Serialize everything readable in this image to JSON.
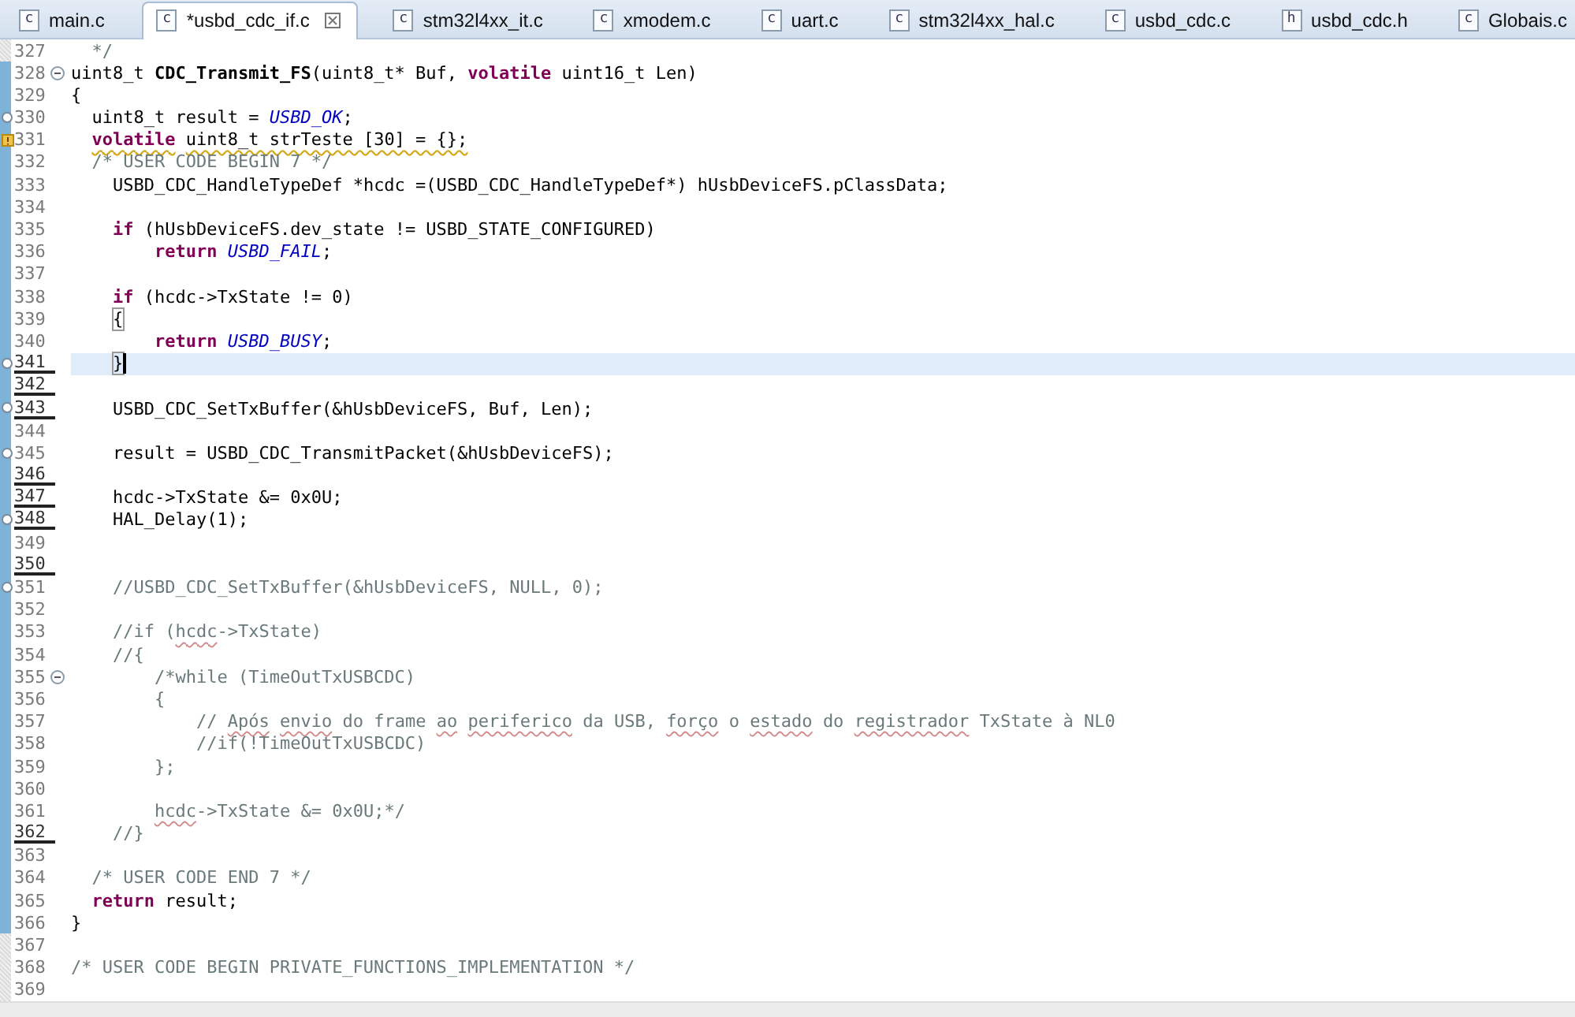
{
  "tabs": [
    {
      "label": "main.c",
      "icon_letter": "c",
      "selected": false,
      "dirty_close": false
    },
    {
      "label": "*usbd_cdc_if.c",
      "icon_letter": "c",
      "selected": true,
      "dirty_close": true
    },
    {
      "label": "stm32l4xx_it.c",
      "icon_letter": "c",
      "selected": false,
      "dirty_close": false
    },
    {
      "label": "xmodem.c",
      "icon_letter": "c",
      "selected": false,
      "dirty_close": false
    },
    {
      "label": "uart.c",
      "icon_letter": "c",
      "selected": false,
      "dirty_close": false
    },
    {
      "label": "stm32l4xx_hal.c",
      "icon_letter": "c",
      "selected": false,
      "dirty_close": false
    },
    {
      "label": "usbd_cdc.c",
      "icon_letter": "c",
      "selected": false,
      "dirty_close": false
    },
    {
      "label": "usbd_cdc.h",
      "icon_letter": "h",
      "selected": false,
      "dirty_close": false
    },
    {
      "label": "Globais.c",
      "icon_letter": "c",
      "selected": false,
      "dirty_close": false
    }
  ],
  "editor": {
    "lines": [
      {
        "number": "327",
        "changed": false,
        "underlined": false,
        "current": false,
        "tokens": [
          {
            "kind": "comment",
            "text": "  */"
          }
        ]
      },
      {
        "number": "328",
        "changed": true,
        "underlined": false,
        "current": false,
        "marker": {
          "kind": "fold"
        },
        "tokens": [
          {
            "kind": "plain",
            "text": "uint8_t "
          },
          {
            "kind": "fn",
            "text": "CDC_Transmit_FS"
          },
          {
            "kind": "plain",
            "text": "(uint8_t* Buf, "
          },
          {
            "kind": "kw",
            "text": "volatile"
          },
          {
            "kind": "plain",
            "text": " uint16_t Len)"
          }
        ]
      },
      {
        "number": "329",
        "changed": true,
        "underlined": false,
        "current": false,
        "tokens": [
          {
            "kind": "plain",
            "text": "{"
          }
        ]
      },
      {
        "number": "330",
        "changed": true,
        "underlined": false,
        "current": false,
        "marker": {
          "kind": "circle"
        },
        "tokens": [
          {
            "kind": "plain",
            "text": "  uint8_t result = "
          },
          {
            "kind": "const",
            "text": "USBD_OK"
          },
          {
            "kind": "plain",
            "text": ";"
          }
        ]
      },
      {
        "number": "331",
        "changed": true,
        "underlined": false,
        "current": false,
        "marker": {
          "kind": "warning"
        },
        "tokens": [
          {
            "kind": "kw",
            "text": "  volatile",
            "warning": true
          },
          {
            "kind": "plain",
            "text": " uint8_t strTeste [30] = {};",
            "warning": true
          }
        ]
      },
      {
        "number": "332",
        "changed": true,
        "underlined": false,
        "current": false,
        "tokens": [
          {
            "kind": "comment",
            "text": "  /* USER CODE BEGIN 7 */"
          }
        ]
      },
      {
        "number": "333",
        "changed": true,
        "underlined": false,
        "current": false,
        "tokens": [
          {
            "kind": "plain",
            "text": "    USBD_CDC_HandleTypeDef *hcdc =(USBD_CDC_HandleTypeDef*) hUsbDeviceFS.pClassData;"
          }
        ]
      },
      {
        "number": "334",
        "changed": true,
        "underlined": false,
        "current": false
      },
      {
        "number": "335",
        "changed": true,
        "underlined": false,
        "current": false,
        "tokens": [
          {
            "kind": "kw",
            "text": "    if"
          },
          {
            "kind": "plain",
            "text": " (hUsbDeviceFS.dev_state != USBD_STATE_CONFIGURED)"
          }
        ]
      },
      {
        "number": "336",
        "changed": true,
        "underlined": false,
        "current": false,
        "tokens": [
          {
            "kind": "kw",
            "text": "        return"
          },
          {
            "kind": "const",
            "text": " USBD_FAIL"
          },
          {
            "kind": "plain",
            "text": ";"
          }
        ]
      },
      {
        "number": "337",
        "changed": true,
        "underlined": false,
        "current": false
      },
      {
        "number": "338",
        "changed": true,
        "underlined": false,
        "current": false,
        "tokens": [
          {
            "kind": "kw",
            "text": "    if"
          },
          {
            "kind": "plain",
            "text": " (hcdc->TxState != 0)"
          }
        ]
      },
      {
        "number": "339",
        "changed": true,
        "underlined": false,
        "current": false,
        "tokens": [
          {
            "kind": "plain",
            "text": "    {",
            "bracket_match": true
          }
        ]
      },
      {
        "number": "340",
        "changed": true,
        "underlined": false,
        "current": false,
        "tokens": [
          {
            "kind": "kw",
            "text": "        return"
          },
          {
            "kind": "const",
            "text": " USBD_BUSY"
          },
          {
            "kind": "plain",
            "text": ";"
          }
        ]
      },
      {
        "number": "341",
        "changed": true,
        "underlined": true,
        "current": true,
        "marker": {
          "kind": "circle"
        },
        "tokens": [
          {
            "kind": "plain",
            "text": "    }",
            "bracket_match": true
          }
        ]
      },
      {
        "number": "342",
        "changed": true,
        "underlined": true,
        "current": false
      },
      {
        "number": "343",
        "changed": true,
        "underlined": true,
        "current": false,
        "marker": {
          "kind": "circle"
        },
        "tokens": [
          {
            "kind": "plain",
            "text": "    USBD_CDC_SetTxBuffer(&hUsbDeviceFS, Buf, Len);"
          }
        ]
      },
      {
        "number": "344",
        "changed": true,
        "underlined": false,
        "current": false
      },
      {
        "number": "345",
        "changed": true,
        "underlined": false,
        "current": false,
        "marker": {
          "kind": "circle"
        },
        "tokens": [
          {
            "kind": "plain",
            "text": "    result = USBD_CDC_TransmitPacket(&hUsbDeviceFS);"
          }
        ]
      },
      {
        "number": "346",
        "changed": true,
        "underlined": true,
        "current": false
      },
      {
        "number": "347",
        "changed": true,
        "underlined": true,
        "current": false,
        "tokens": [
          {
            "kind": "plain",
            "text": "    hcdc->TxState &= 0x0U;"
          }
        ]
      },
      {
        "number": "348",
        "changed": true,
        "underlined": true,
        "current": false,
        "marker": {
          "kind": "circle"
        },
        "tokens": [
          {
            "kind": "plain",
            "text": "    HAL_Delay(1);"
          }
        ]
      },
      {
        "number": "349",
        "changed": true,
        "underlined": false,
        "current": false
      },
      {
        "number": "350",
        "changed": true,
        "underlined": true,
        "current": false
      },
      {
        "number": "351",
        "changed": true,
        "underlined": false,
        "current": false,
        "marker": {
          "kind": "circle"
        },
        "tokens": [
          {
            "kind": "comment",
            "text": "    //USBD_CDC_SetTxBuffer(&hUsbDeviceFS, NULL, 0);"
          }
        ]
      },
      {
        "number": "352",
        "changed": true,
        "underlined": false,
        "current": false
      },
      {
        "number": "353",
        "changed": true,
        "underlined": false,
        "current": false,
        "tokens": [
          {
            "kind": "comment",
            "text": "    //if ("
          },
          {
            "kind": "comment",
            "text": "hcdc",
            "misspelled": true
          },
          {
            "kind": "comment",
            "text": "->TxState)"
          }
        ]
      },
      {
        "number": "354",
        "changed": true,
        "underlined": false,
        "current": false,
        "tokens": [
          {
            "kind": "comment",
            "text": "    //{"
          }
        ]
      },
      {
        "number": "355",
        "changed": true,
        "underlined": false,
        "current": false,
        "marker": {
          "kind": "fold"
        },
        "tokens": [
          {
            "kind": "comment",
            "text": "        /*while (TimeOutTxUSBCDC)"
          }
        ]
      },
      {
        "number": "356",
        "changed": true,
        "underlined": false,
        "current": false,
        "tokens": [
          {
            "kind": "comment",
            "text": "        {"
          }
        ]
      },
      {
        "number": "357",
        "changed": true,
        "underlined": false,
        "current": false,
        "tokens": [
          {
            "kind": "comment",
            "text": "            // "
          },
          {
            "kind": "comment",
            "text": "Após",
            "misspelled": true
          },
          {
            "kind": "comment",
            "text": " envio",
            "misspelled": true
          },
          {
            "kind": "comment",
            "text": " do frame "
          },
          {
            "kind": "comment",
            "text": "ao",
            "misspelled": true
          },
          {
            "kind": "comment",
            "text": " periferico",
            "misspelled": true
          },
          {
            "kind": "comment",
            "text": " da USB, "
          },
          {
            "kind": "comment",
            "text": "forço",
            "misspelled": true
          },
          {
            "kind": "comment",
            "text": " o "
          },
          {
            "kind": "comment",
            "text": "estado",
            "misspelled": true
          },
          {
            "kind": "comment",
            "text": " do "
          },
          {
            "kind": "comment",
            "text": "registrador",
            "misspelled": true
          },
          {
            "kind": "comment",
            "text": " TxState à NL0"
          }
        ]
      },
      {
        "number": "358",
        "changed": true,
        "underlined": false,
        "current": false,
        "tokens": [
          {
            "kind": "comment",
            "text": "            //if(!TimeOutTxUSBCDC)"
          }
        ]
      },
      {
        "number": "359",
        "changed": true,
        "underlined": false,
        "current": false,
        "tokens": [
          {
            "kind": "comment",
            "text": "        };"
          }
        ]
      },
      {
        "number": "360",
        "changed": true,
        "underlined": false,
        "current": false
      },
      {
        "number": "361",
        "changed": true,
        "underlined": false,
        "current": false,
        "tokens": [
          {
            "kind": "comment",
            "text": "        hcdc",
            "misspelled": true
          },
          {
            "kind": "comment",
            "text": "->TxState &= 0x0U;*/"
          }
        ]
      },
      {
        "number": "362",
        "changed": true,
        "underlined": true,
        "current": false,
        "tokens": [
          {
            "kind": "comment",
            "text": "    //}"
          }
        ]
      },
      {
        "number": "363",
        "changed": true,
        "underlined": false,
        "current": false
      },
      {
        "number": "364",
        "changed": true,
        "underlined": false,
        "current": false,
        "tokens": [
          {
            "kind": "comment",
            "text": "  /* USER CODE END 7 */"
          }
        ]
      },
      {
        "number": "365",
        "changed": true,
        "underlined": false,
        "current": false,
        "tokens": [
          {
            "kind": "kw",
            "text": "  return"
          },
          {
            "kind": "plain",
            "text": " result;"
          }
        ]
      },
      {
        "number": "366",
        "changed": true,
        "underlined": false,
        "current": false,
        "tokens": [
          {
            "kind": "plain",
            "text": "}"
          }
        ]
      },
      {
        "number": "367",
        "changed": false,
        "underlined": false,
        "current": false
      },
      {
        "number": "368",
        "changed": false,
        "underlined": false,
        "current": false,
        "tokens": [
          {
            "kind": "comment",
            "text": "/* USER CODE BEGIN PRIVATE_FUNCTIONS_IMPLEMENTATION */"
          }
        ]
      },
      {
        "number": "369",
        "changed": false,
        "underlined": false,
        "current": false
      }
    ]
  }
}
